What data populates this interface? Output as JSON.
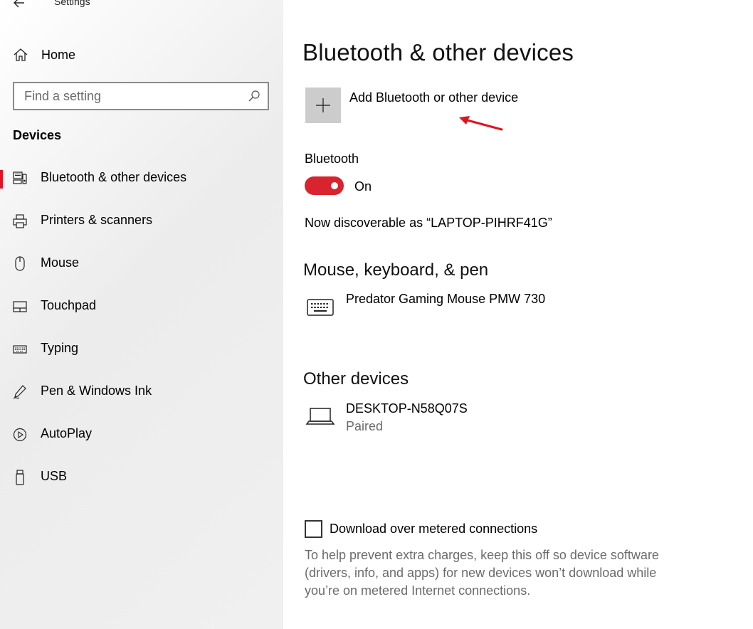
{
  "window": {
    "title": "Settings"
  },
  "sidebar": {
    "home_label": "Home",
    "search_placeholder": "Find a setting",
    "section_title": "Devices",
    "items": [
      {
        "label": "Bluetooth & other devices",
        "icon": "bluetooth-devices-icon",
        "active": true
      },
      {
        "label": "Printers & scanners",
        "icon": "printer-icon",
        "active": false
      },
      {
        "label": "Mouse",
        "icon": "mouse-icon",
        "active": false
      },
      {
        "label": "Touchpad",
        "icon": "touchpad-icon",
        "active": false
      },
      {
        "label": "Typing",
        "icon": "keyboard-icon",
        "active": false
      },
      {
        "label": "Pen & Windows Ink",
        "icon": "pen-icon",
        "active": false
      },
      {
        "label": "AutoPlay",
        "icon": "autoplay-icon",
        "active": false
      },
      {
        "label": "USB",
        "icon": "usb-icon",
        "active": false
      }
    ]
  },
  "main": {
    "title": "Bluetooth & other devices",
    "add_device_label": "Add Bluetooth or other device",
    "bluetooth_label": "Bluetooth",
    "bluetooth_state": "On",
    "discoverable_text": "Now discoverable as “LAPTOP-PIHRF41G”",
    "groups": [
      {
        "title": "Mouse, keyboard, & pen",
        "devices": [
          {
            "name": "Predator Gaming Mouse PMW 730",
            "status": "",
            "icon": "keyboard-icon"
          }
        ]
      },
      {
        "title": "Other devices",
        "devices": [
          {
            "name": "DESKTOP-N58Q07S",
            "status": "Paired",
            "icon": "laptop-icon"
          }
        ]
      }
    ],
    "metered_label": "Download over metered connections",
    "metered_help": "To help prevent extra charges, keep this off so device software (drivers, info, and apps) for new devices won’t download while you’re on metered Internet connections."
  },
  "colors": {
    "accent": "#d9232f",
    "active_indicator": "#e81123",
    "annotation_arrow": "#e0141e",
    "tile_gray": "#cccccc",
    "secondary_text": "#6b6b6b"
  }
}
